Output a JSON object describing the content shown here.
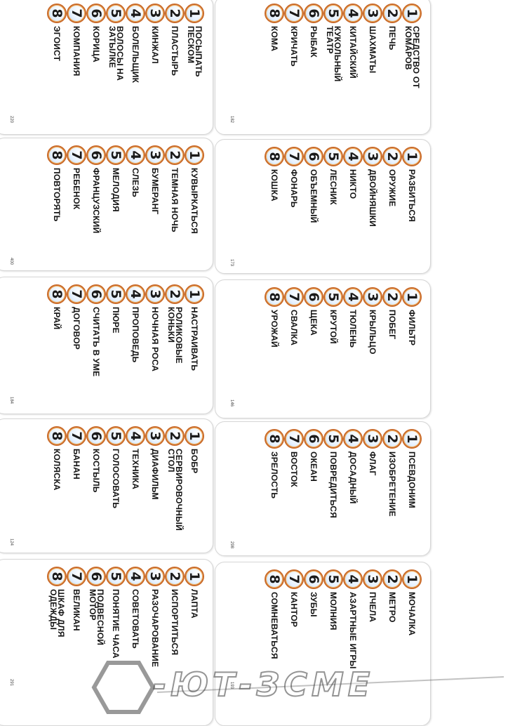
{
  "cards": [
    {
      "id": "card-1",
      "number": "220",
      "items": [
        {
          "n": "1",
          "text": "ПОСЫПАТЬ\nПЕСКОМ"
        },
        {
          "n": "2",
          "text": "ПЛАСТЫРЬ"
        },
        {
          "n": "3",
          "text": "КИНЖАЛ"
        },
        {
          "n": "4",
          "text": "БОЛЕЛЬЩИК"
        },
        {
          "n": "5",
          "text": "ВОЛОСЫ НА\nЗАТЫЛКЕ"
        },
        {
          "n": "6",
          "text": "КОРИЦА"
        },
        {
          "n": "7",
          "text": "КОМПАНИЯ"
        },
        {
          "n": "8",
          "text": "ЭГОИСТ"
        }
      ]
    },
    {
      "id": "card-2",
      "number": "182",
      "items": [
        {
          "n": "1",
          "text": "СРЕДСТВО ОТ\nКОМАРОВ"
        },
        {
          "n": "2",
          "text": "ПЕЧЬ"
        },
        {
          "n": "3",
          "text": "ШАХМАТЫ"
        },
        {
          "n": "4",
          "text": "КИТАЙСКИЙ"
        },
        {
          "n": "5",
          "text": "КУКОЛЬНЫЙ\nТЕАТР"
        },
        {
          "n": "6",
          "text": "РЫБАК"
        },
        {
          "n": "7",
          "text": "КРИЧАТЬ"
        },
        {
          "n": "8",
          "text": "КОМА"
        }
      ]
    },
    {
      "id": "card-3",
      "number": "400",
      "items": [
        {
          "n": "1",
          "text": "КУВЫРКАТЬСЯ"
        },
        {
          "n": "2",
          "text": "ТЕМНАЯ НОЧЬ"
        },
        {
          "n": "3",
          "text": "БУМЕРАНГ"
        },
        {
          "n": "4",
          "text": "СЛЕЗЬ"
        },
        {
          "n": "5",
          "text": "МЕЛОДИЯ"
        },
        {
          "n": "6",
          "text": "ФРАНЦУЗСКИЙ"
        },
        {
          "n": "7",
          "text": "РЕБЕНОК"
        },
        {
          "n": "8",
          "text": "ПОВТОРЯТЬ"
        }
      ]
    },
    {
      "id": "card-4",
      "number": "173",
      "items": [
        {
          "n": "1",
          "text": "РАЗБИТЬСЯ"
        },
        {
          "n": "2",
          "text": "ОРУЖИЕ"
        },
        {
          "n": "3",
          "text": "ДВОЙНЯШКИ"
        },
        {
          "n": "4",
          "text": "НИКТО"
        },
        {
          "n": "5",
          "text": "ЛЕСНИК"
        },
        {
          "n": "6",
          "text": "ОБЪЕМНЫЙ"
        },
        {
          "n": "7",
          "text": "ФОНАРЬ"
        },
        {
          "n": "8",
          "text": "КОШКА"
        }
      ]
    },
    {
      "id": "card-5",
      "number": "184",
      "items": [
        {
          "n": "1",
          "text": "НАСТРАИВАТЬ"
        },
        {
          "n": "2",
          "text": "РОЛИКОВЫЕ\nКОНЬКИ"
        },
        {
          "n": "3",
          "text": "НОЧНАЯ РОСА"
        },
        {
          "n": "4",
          "text": "ПРОПОВЕДЬ"
        },
        {
          "n": "5",
          "text": "ПЮРЕ"
        },
        {
          "n": "6",
          "text": "СЧИТАТЬ В УМЕ"
        },
        {
          "n": "7",
          "text": "ДОГОВОР"
        },
        {
          "n": "8",
          "text": "КРАЙ"
        }
      ]
    },
    {
      "id": "card-6",
      "number": "146",
      "items": [
        {
          "n": "1",
          "text": "ФИЛЬТР"
        },
        {
          "n": "2",
          "text": "ПОБЕГ"
        },
        {
          "n": "3",
          "text": "КРЫЛЬЦО"
        },
        {
          "n": "4",
          "text": "ТЮЛЕНЬ"
        },
        {
          "n": "5",
          "text": "КРУТОЙ"
        },
        {
          "n": "6",
          "text": "ЩЕКА"
        },
        {
          "n": "7",
          "text": "СВАЛКА"
        },
        {
          "n": "8",
          "text": "УРОЖАЙ"
        }
      ]
    },
    {
      "id": "card-7",
      "number": "124",
      "items": [
        {
          "n": "1",
          "text": "БОБР"
        },
        {
          "n": "2",
          "text": "СЕРВИРОВОЧНЫЙ\nСТОЛ"
        },
        {
          "n": "3",
          "text": "ДИАФИЛЬМ"
        },
        {
          "n": "4",
          "text": "ТЕХНИКА"
        },
        {
          "n": "5",
          "text": "ГОЛОСОВАТЬ"
        },
        {
          "n": "6",
          "text": "КОСТЫЛЬ"
        },
        {
          "n": "7",
          "text": "БАНАН"
        },
        {
          "n": "8",
          "text": "КОЛЯСКА"
        }
      ]
    },
    {
      "id": "card-8",
      "number": "298",
      "items": [
        {
          "n": "1",
          "text": "ПСЕВДОНИМ"
        },
        {
          "n": "2",
          "text": "ИЗОБРЕТЕНИЕ"
        },
        {
          "n": "3",
          "text": "ФЛАГ"
        },
        {
          "n": "4",
          "text": "ДОСАДНЫЙ"
        },
        {
          "n": "5",
          "text": "ПОВРЕДИТЬСЯ"
        },
        {
          "n": "6",
          "text": "ОКЕАН"
        },
        {
          "n": "7",
          "text": "ВОСТОК"
        },
        {
          "n": "8",
          "text": "ЗРЕЛОСТЬ"
        }
      ]
    },
    {
      "id": "card-9",
      "number": "291",
      "items": [
        {
          "n": "1",
          "text": "ЛАПТА"
        },
        {
          "n": "2",
          "text": "ИСПОРТИТЬСЯ"
        },
        {
          "n": "3",
          "text": "РАЗОЧАРОВАНИЕ"
        },
        {
          "n": "4",
          "text": "СОВЕТОВАТЬ"
        },
        {
          "n": "5",
          "text": "ПОНЯТИЕ ЧАСА"
        },
        {
          "n": "6",
          "text": "ПОДВЕСНОЙ\nМОТОР"
        },
        {
          "n": "7",
          "text": "ВЕЛИКАН"
        },
        {
          "n": "8",
          "text": "ШКАФ ДЛЯ\nОДЕЖДЫ"
        }
      ]
    },
    {
      "id": "card-10",
      "number": "193",
      "items": [
        {
          "n": "1",
          "text": "МОЧАЛКА"
        },
        {
          "n": "2",
          "text": "МЕТРО"
        },
        {
          "n": "3",
          "text": "ПЧЕЛА"
        },
        {
          "n": "4",
          "text": "АЗАРТНЫЕ ИГРЫ"
        },
        {
          "n": "5",
          "text": "МОЛНИЯ"
        },
        {
          "n": "6",
          "text": "ЗУБЫ"
        },
        {
          "n": "7",
          "text": "КАНТОР"
        },
        {
          "n": "8",
          "text": "СОМНЕВАТЬСЯ"
        }
      ]
    }
  ],
  "watermark": {
    "text": "-ЮТ-ЗСМЕ"
  },
  "colors": {
    "ring": "#c96a2a",
    "ring_inner": "#f2b05a",
    "badge_fill": "#e8f2ff",
    "text": "#141414"
  }
}
